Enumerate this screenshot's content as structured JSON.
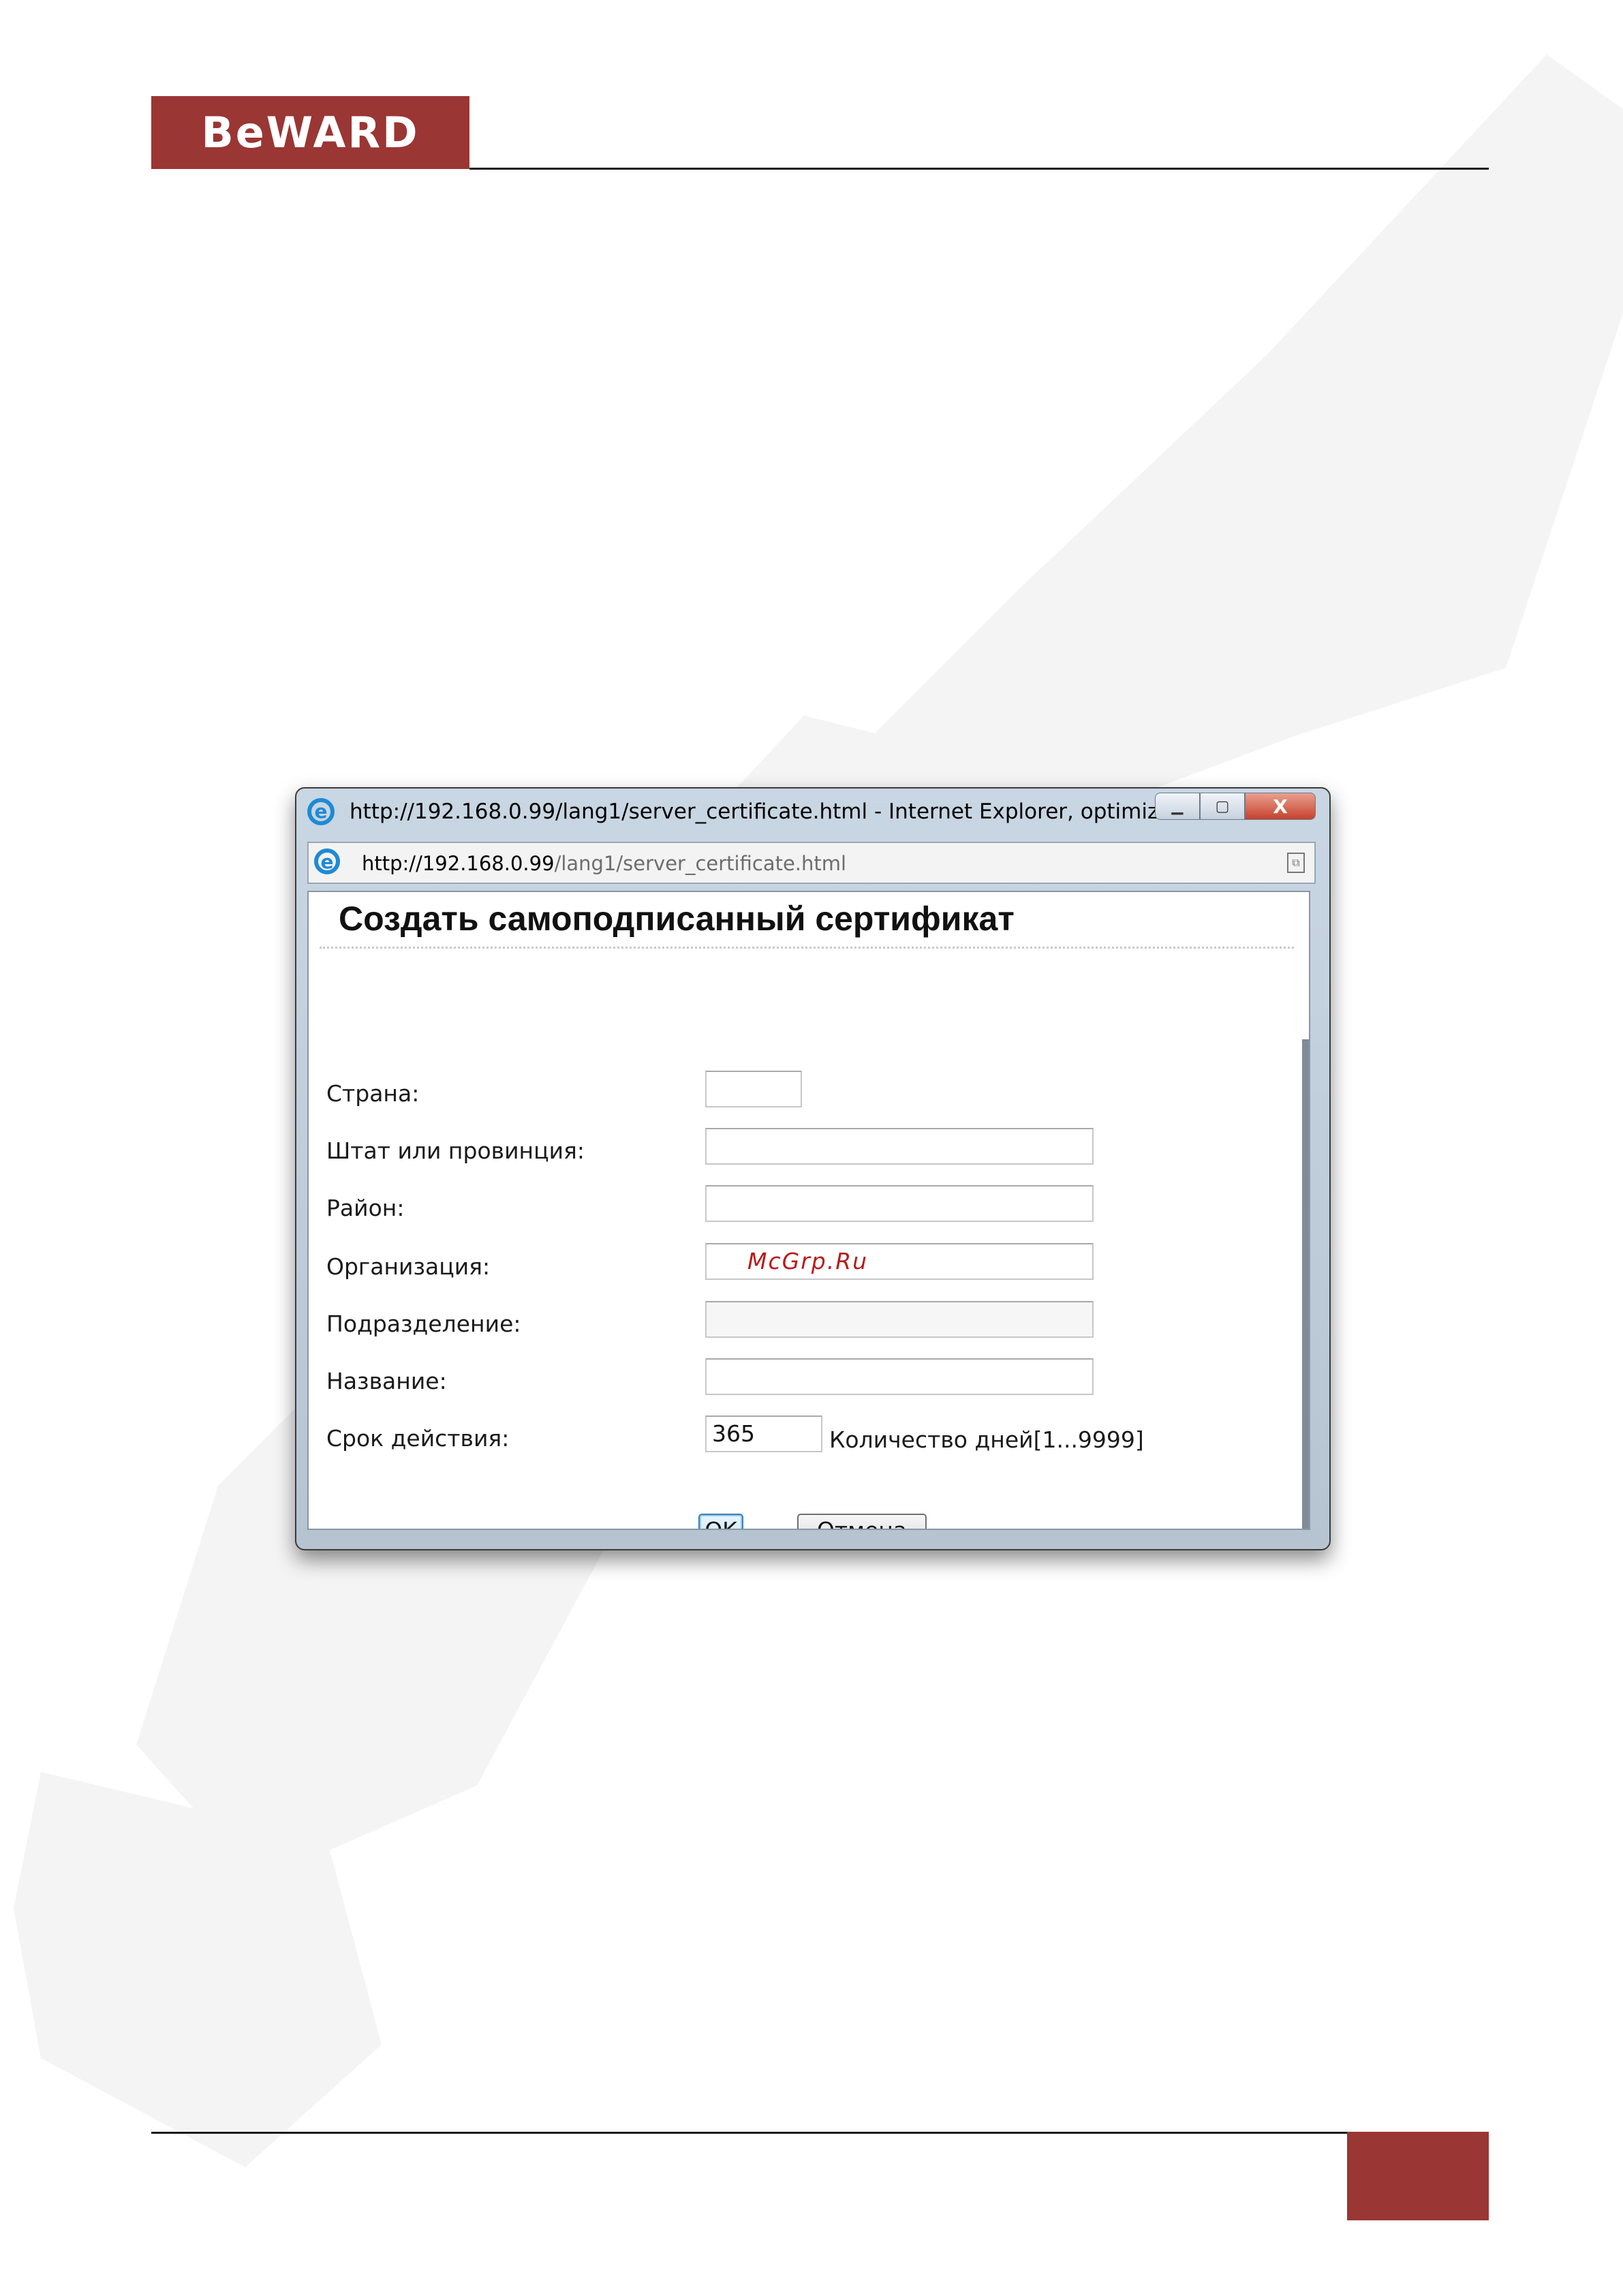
{
  "header": {
    "logo_text": "BeWARD"
  },
  "browser": {
    "title": "http://192.168.0.99/lang1/server_certificate.html - Internet Explorer, optimized ...",
    "address_host": "http://192.168.0.99",
    "address_path": "/lang1/server_certificate.html",
    "controls": {
      "minimize": "▁",
      "maximize": "▢",
      "close": "X"
    }
  },
  "form": {
    "title": "Создать самоподписанный сертификат",
    "fields": [
      {
        "label": "Страна:",
        "value": ""
      },
      {
        "label": "Штат или провинция:",
        "value": ""
      },
      {
        "label": "Район:",
        "value": ""
      },
      {
        "label": "Организация:",
        "value": "McGrp.Ru"
      },
      {
        "label": "Подразделение:",
        "value": ""
      },
      {
        "label": "Название:",
        "value": ""
      },
      {
        "label": "Срок действия:",
        "value": "365"
      }
    ],
    "validity_hint": "Количество дней[1...9999]",
    "ok_label": "OK",
    "cancel_label": "Отмена"
  },
  "colors": {
    "brand": "#9a3634",
    "watermark": "#f4f4f4"
  },
  "icons": [
    "internet-explorer-icon",
    "compatibility-view-icon"
  ]
}
